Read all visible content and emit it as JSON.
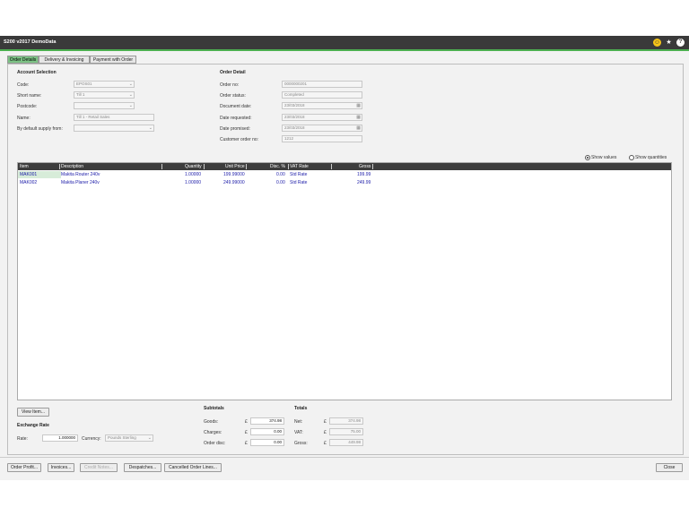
{
  "window": {
    "title": "S200 v2017 DemoData"
  },
  "titlebar_icons": [
    "smiley-icon",
    "star-icon",
    "help-icon"
  ],
  "tabs": [
    {
      "label": "Order Details",
      "active": true
    },
    {
      "label": "Delivery & Invoicing",
      "active": false
    },
    {
      "label": "Payment with Order",
      "active": false
    }
  ],
  "account": {
    "heading": "Account Selection",
    "code_label": "Code:",
    "code_value": "EPOS01",
    "short_name_label": "Short name:",
    "short_name_value": "Till 1",
    "postcode_label": "Postcode:",
    "postcode_value": "",
    "name_label": "Name:",
    "name_value": "Till 1 - Retail Sales",
    "supply_label": "By default supply from:",
    "supply_value": ""
  },
  "order_detail": {
    "heading": "Order Detail",
    "order_no_label": "Order no:",
    "order_no_value": "0000000201",
    "status_label": "Order status:",
    "status_value": "Completed",
    "doc_date_label": "Document date:",
    "doc_date_value": "23/03/2018",
    "date_req_label": "Date requested:",
    "date_req_value": "23/03/2018",
    "date_prom_label": "Date promised:",
    "date_prom_value": "23/03/2018",
    "cust_order_label": "Customer order no:",
    "cust_order_value": "1212"
  },
  "view_options": {
    "show_values": "Show values",
    "show_quantities": "Show quantities",
    "selected": "values"
  },
  "grid": {
    "columns": [
      "Item",
      "Description",
      "Quantity",
      "Unit Price",
      "Disc. %",
      "VAT Rate",
      "Gross"
    ],
    "rows": [
      {
        "item": "MAK001",
        "description": "Makita Router 240v",
        "quantity": "1.00000",
        "unit_price": "199.99000",
        "disc": "0.00",
        "vat": "Std Rate",
        "gross": "199.99"
      },
      {
        "item": "MAK002",
        "description": "Makita Planer 240v",
        "quantity": "1.00000",
        "unit_price": "249.99000",
        "disc": "0.00",
        "vat": "Std Rate",
        "gross": "249.99"
      }
    ]
  },
  "view_item_button": "View Item...",
  "exchange": {
    "heading": "Exchange Rate",
    "rate_label": "Rate:",
    "rate_value": "1.000000",
    "currency_label": "Currency:",
    "currency_value": "Pounds Sterling"
  },
  "subtotals": {
    "heading": "Subtotals",
    "currency": "£",
    "goods_label": "Goods:",
    "goods_value": "374.98",
    "charges_label": "Charges:",
    "charges_value": "0.00",
    "order_disc_label": "Order disc:",
    "order_disc_value": "0.00"
  },
  "totals": {
    "heading": "Totals",
    "currency": "£",
    "net_label": "Net:",
    "net_value": "374.98",
    "vat_label": "VAT:",
    "vat_value": "75.00",
    "gross_label": "Gross:",
    "gross_value": "449.98"
  },
  "bottom_buttons": {
    "order_profit": "Order Profit...",
    "invoices": "Invoices...",
    "credit_notes": "Credit Notes...",
    "despatches": "Despatches...",
    "cancelled_lines": "Cancelled Order Lines...",
    "close": "Close"
  },
  "colors": {
    "titlebar": "#3a3a3a",
    "accent_green": "#4caf50",
    "active_tab": "#7cc285",
    "grid_text": "#1a1aa8"
  }
}
